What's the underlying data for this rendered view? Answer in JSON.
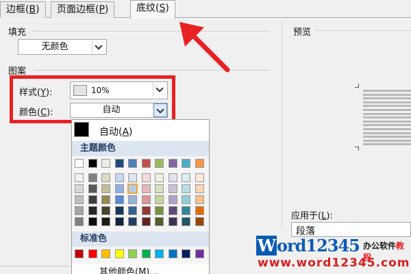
{
  "tabs": [
    {
      "label": "边框(",
      "key": "B",
      "tail": ")"
    },
    {
      "label": "页面边框(",
      "key": "P",
      "tail": ")"
    },
    {
      "label": "底纹(",
      "key": "S",
      "tail": ")"
    }
  ],
  "fill": {
    "section_label": "填充",
    "selected": "无颜色"
  },
  "pattern": {
    "section_label": "图案",
    "style_label": "样式(",
    "style_key": "Y",
    "style_tail": "):",
    "style_value": "10%",
    "color_label": "颜色(",
    "color_key": "C",
    "color_tail": "):",
    "color_value": "自动"
  },
  "color_popup": {
    "auto_label": "自动(",
    "auto_key": "A",
    "auto_tail": ")",
    "theme_header": "主题颜色",
    "standard_header": "标准色",
    "more_label": "其他颜色(M)...",
    "theme_top": [
      "#ffffff",
      "#000000",
      "#eeece1",
      "#1f497d",
      "#4f81bd",
      "#c0504d",
      "#9bbb59",
      "#8064a2",
      "#4bacc6",
      "#f79646"
    ],
    "theme_shades": [
      [
        "#f2f2f2",
        "#7f7f7f",
        "#ddd9c3",
        "#c6d9f0",
        "#dbe5f1",
        "#f2dcdb",
        "#ebf1dd",
        "#e5e0ec",
        "#dbeef3",
        "#fdeada"
      ],
      [
        "#d8d8d8",
        "#595959",
        "#c4bd97",
        "#8db3e2",
        "#b8cce4",
        "#e5b9b7",
        "#d7e3bc",
        "#ccc1d9",
        "#b7dde8",
        "#fbd5b5"
      ],
      [
        "#bfbfbf",
        "#3f3f3f",
        "#938953",
        "#548dd4",
        "#95b3d7",
        "#d99694",
        "#c3d69b",
        "#b2a2c7",
        "#92cddc",
        "#fac08f"
      ],
      [
        "#a5a5a5",
        "#262626",
        "#494429",
        "#17365d",
        "#366092",
        "#953734",
        "#76923c",
        "#5f497a",
        "#31859b",
        "#e36c09"
      ],
      [
        "#7f7f7f",
        "#0c0c0c",
        "#1d1b10",
        "#0f243e",
        "#244061",
        "#632423",
        "#4f6128",
        "#3f3151",
        "#205867",
        "#974806"
      ]
    ],
    "selected_swatch": [
      1,
      4
    ],
    "standard": [
      "#c00000",
      "#ff0000",
      "#ffc000",
      "#ffff00",
      "#92d050",
      "#00b050",
      "#00b0f0",
      "#0070c0",
      "#002060",
      "#7030a0"
    ]
  },
  "preview": {
    "label": "预览",
    "apply_label": "应用于(",
    "apply_key": "L",
    "apply_tail": "):",
    "apply_value": "段落"
  },
  "watermark": {
    "word_prefix": "W",
    "word_rest": "ord12345",
    "cn_black": "办公软件",
    "cn_red": "教程",
    "url": "www.word12345.com"
  },
  "colors": {
    "highlight": "#e82124",
    "accent": "#0b5bb5"
  }
}
